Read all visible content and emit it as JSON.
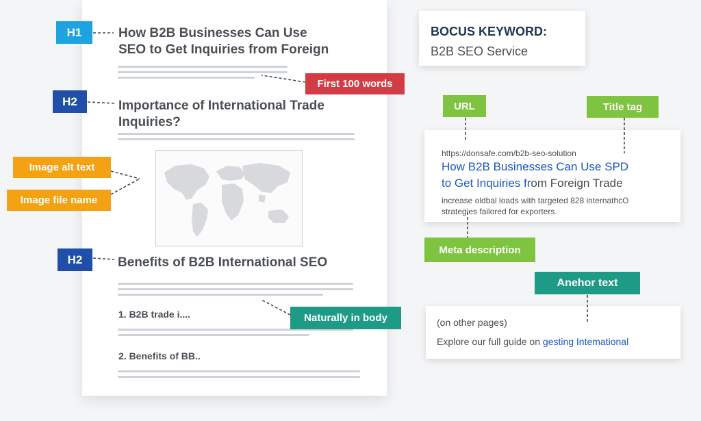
{
  "document": {
    "h1_text_line1": "How B2B Businesses Can Use",
    "h1_text_line2": "SEO to Get Inquiries from Foreign",
    "h2a_text_line1": "Importance of International Trade",
    "h2a_text_line2": "Inquiries?",
    "h2b_text": "Benefits of B2B International SEO",
    "list_item_1": "1. B2B trade i....",
    "list_item_2": "2. Benefits of BB.."
  },
  "labels": {
    "h1": "H1",
    "h2_first": "H2",
    "h2_second": "H2",
    "first_100_words": "First 100 words",
    "image_alt_text": "Image alt text",
    "image_file_name": "Image file name",
    "naturally_in_body": "Naturally in body",
    "url": "URL",
    "title_tag": "Title tag",
    "meta_description": "Meta description",
    "anchor_text": "Anehor text"
  },
  "focus_keyword": {
    "title": "BOCUS KEYWORD:",
    "value": "B2B SEO Service"
  },
  "serp": {
    "url": "https://donsafe.com/b2b-seo-solution",
    "title_line1": "How B2B Businesses Can Use SPD",
    "title_line2_link": "to Get Inquiries fr",
    "title_line2_rest": "om Foreign Trade",
    "desc_line1": "increase oldbal loads with targeted 828 internathcO",
    "desc_line2": "strategies failored for exporters."
  },
  "anchor_card": {
    "context": "(on other pages)",
    "sentence_prefix": "Explore our full guide on ",
    "sentence_link": "gesting Intemational"
  },
  "colors": {
    "h1_blue": "#1ea3e0",
    "h2_navy": "#1f4fa8",
    "red": "#d23c44",
    "orange": "#f4a213",
    "green": "#7fc440",
    "teal": "#1d9b86",
    "link_blue": "#1a56c7"
  }
}
